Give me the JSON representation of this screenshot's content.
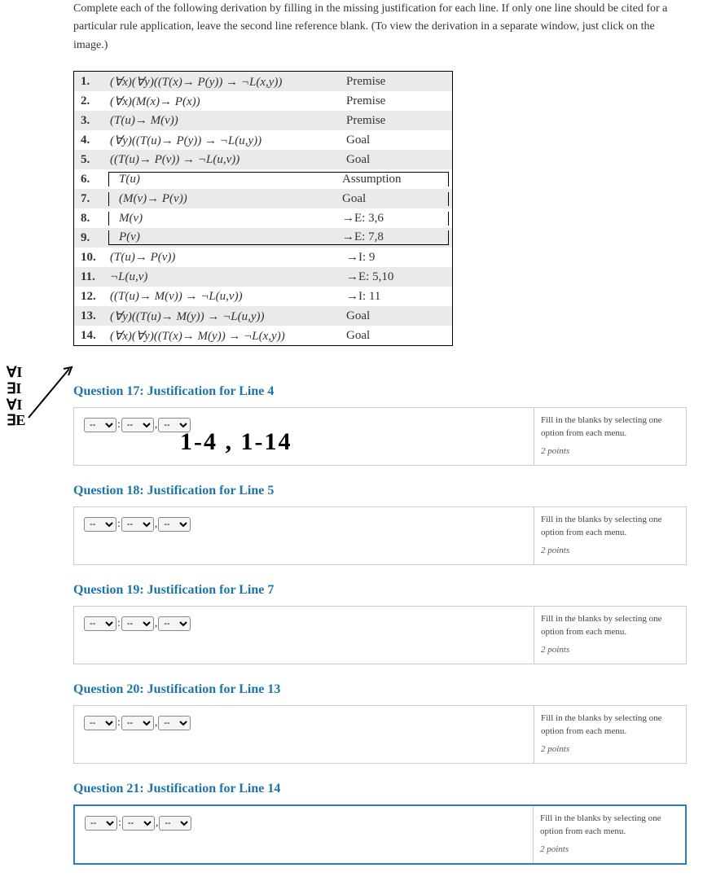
{
  "instructions": "Complete each of the following derivation by filling in the missing justification for each line. If only one line should be cited for a particular rule application, leave the second line reference blank. (To view the derivation in a separate window, just click on the image.)",
  "derivation": [
    {
      "n": "1.",
      "f": "(∀x)(∀y)((T(x)→ P(y)) → ¬L(x,y))",
      "j": "Premise",
      "shade": true,
      "box": false
    },
    {
      "n": "2.",
      "f": "(∀x)(M(x)→ P(x))",
      "j": "Premise",
      "shade": false,
      "box": false
    },
    {
      "n": "3.",
      "f": "(T(u)→ M(v))",
      "j": "Premise",
      "shade": true,
      "box": false
    },
    {
      "n": "4.",
      "f": "(∀y)((T(u)→ P(y)) → ¬L(u,y))",
      "j": "Goal",
      "shade": false,
      "box": false
    },
    {
      "n": "5.",
      "f": "((T(u)→ P(v)) → ¬L(u,v))",
      "j": "Goal",
      "shade": true,
      "box": false
    },
    {
      "n": "6.",
      "f": "T(u)",
      "j": "Assumption",
      "shade": false,
      "box": true,
      "boxtop": true
    },
    {
      "n": "7.",
      "f": "(M(v)→ P(v))",
      "j": "Goal",
      "shade": true,
      "box": true
    },
    {
      "n": "8.",
      "f": "M(v)",
      "j": "→E: 3,6",
      "shade": false,
      "box": true
    },
    {
      "n": "9.",
      "f": "P(v)",
      "j": "→E: 7,8",
      "shade": true,
      "box": true,
      "boxbot": true
    },
    {
      "n": "10.",
      "f": "(T(u)→ P(v))",
      "j": "→I: 9",
      "shade": false,
      "box": false
    },
    {
      "n": "11.",
      "f": "¬L(u,v)",
      "j": "→E: 5,10",
      "shade": true,
      "box": false
    },
    {
      "n": "12.",
      "f": "((T(u)→ M(v)) → ¬L(u,v))",
      "j": "→I: 11",
      "shade": false,
      "box": false
    },
    {
      "n": "13.",
      "f": "(∀y)((T(u)→ M(y)) → ¬L(u,y))",
      "j": "Goal",
      "shade": true,
      "box": false
    },
    {
      "n": "14.",
      "f": "(∀x)(∀y)((T(x)→ M(y)) → ¬L(x,y))",
      "j": "Goal",
      "shade": false,
      "box": false
    }
  ],
  "questions": [
    {
      "num": "17",
      "line": "4",
      "highlight": false,
      "handwrite": "1-4 , 1-14"
    },
    {
      "num": "18",
      "line": "5",
      "highlight": false
    },
    {
      "num": "19",
      "line": "7",
      "highlight": false
    },
    {
      "num": "20",
      "line": "13",
      "highlight": false
    },
    {
      "num": "21",
      "line": "14",
      "highlight": true
    }
  ],
  "question_prefix": "Question ",
  "question_mid": ": Justification for Line ",
  "select_placeholder": "--",
  "colon": ":",
  "comma": ",",
  "hint_text": "Fill in the blanks by selecting one option from each menu.",
  "points_text": "2 points",
  "handwriting_side": [
    "∀I",
    "∃I",
    "∀I",
    "∃E"
  ]
}
